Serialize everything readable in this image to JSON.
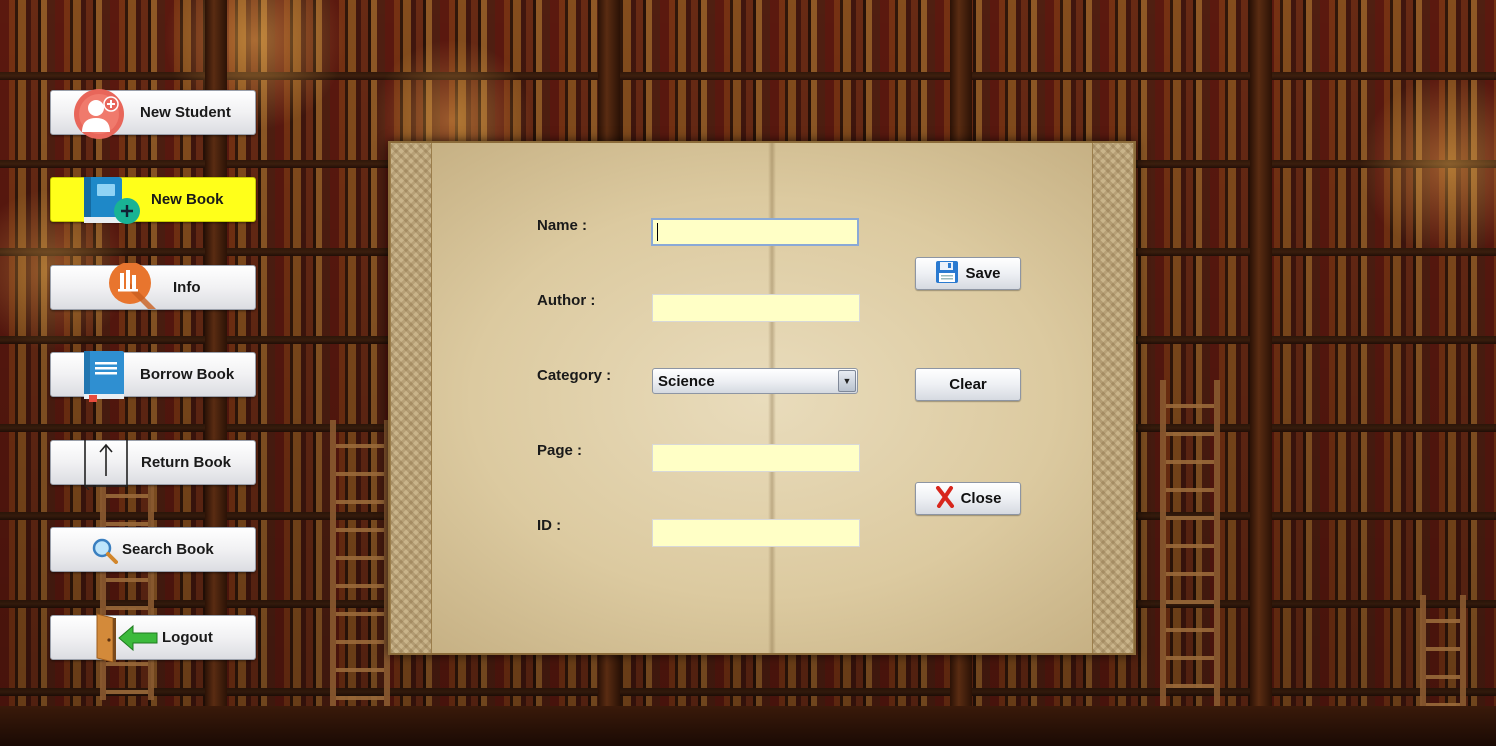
{
  "menu": {
    "new_student": "New Student",
    "new_book": "New Book",
    "info": "Info",
    "borrow_book": "Borrow Book",
    "return_book": "Return Book",
    "search_book": "Search Book",
    "logout": "Logout",
    "active_item": "New Book"
  },
  "form": {
    "name_label": "Name :",
    "name_value": "",
    "author_label": "Author :",
    "author_value": "",
    "category_label": "Category :",
    "category_value": "Science",
    "page_label": "Page :",
    "page_value": "",
    "id_label": "ID :",
    "id_value": ""
  },
  "actions": {
    "save": "Save",
    "clear": "Clear",
    "close": "Close"
  },
  "colors": {
    "active_menu": "#ffff1a",
    "field_bg": "#ffffc6"
  },
  "icons": {
    "new_student": "add-user-icon",
    "new_book": "add-book-icon",
    "info": "info-chart-icon",
    "borrow_book": "book-icon",
    "return_book": "return-arrow-icon",
    "search_book": "magnifier-icon",
    "logout": "exit-door-icon",
    "save": "floppy-disk-icon",
    "close": "red-x-icon"
  }
}
